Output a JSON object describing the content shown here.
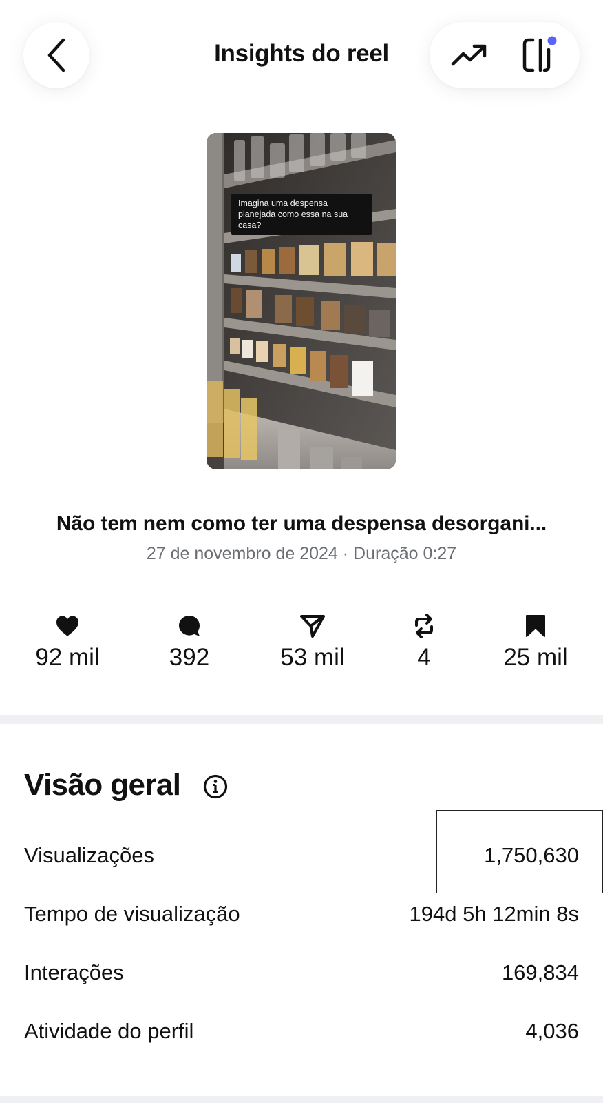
{
  "header": {
    "title": "Insights do reel",
    "back_icon": "chevron-left-icon",
    "trend_icon": "trending-up-icon",
    "panel_icon": "side-panel-icon",
    "notification_dot_color": "#5b63f5"
  },
  "reel": {
    "overlay_text": "Imagina uma despensa planejada como essa na sua casa?",
    "title": "Não tem nem como ter uma despensa desorgani...",
    "meta": "27 de novembro de 2024 · Duração 0:27"
  },
  "stats": [
    {
      "icon": "heart-icon",
      "value": "92 mil"
    },
    {
      "icon": "comment-icon",
      "value": "392"
    },
    {
      "icon": "send-icon",
      "value": "53 mil"
    },
    {
      "icon": "repost-icon",
      "value": "4"
    },
    {
      "icon": "bookmark-icon",
      "value": "25 mil"
    }
  ],
  "overview": {
    "title": "Visão geral",
    "info_icon": "info-icon",
    "rows": [
      {
        "label": "Visualizações",
        "value": "1,750,630"
      },
      {
        "label": "Tempo de visualização",
        "value": "194d 5h 12min 8s"
      },
      {
        "label": "Interações",
        "value": "169,834"
      },
      {
        "label": "Atividade do perfil",
        "value": "4,036"
      }
    ]
  }
}
